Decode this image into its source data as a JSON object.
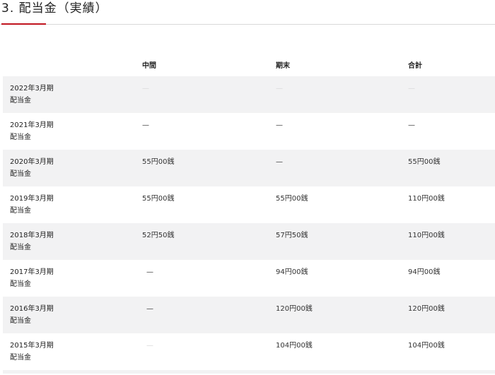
{
  "section": {
    "title": "3. 配当金（実績）"
  },
  "table": {
    "headers": [
      "中間",
      "期末",
      "合計"
    ],
    "rows": [
      {
        "period": "2022年3月期",
        "label": "配当金",
        "interim": "—",
        "year_end": "—",
        "total": "—",
        "faint": true
      },
      {
        "period": "2021年3月期",
        "label": "配当金",
        "interim": "—",
        "year_end": "—",
        "total": "—",
        "faint": false
      },
      {
        "period": "2020年3月期",
        "label": "配当金",
        "interim": "55円00銭",
        "year_end": "—",
        "total": "55円00銭",
        "faint": false
      },
      {
        "period": "2019年3月期",
        "label": "配当金",
        "interim": "55円00銭",
        "year_end": "55円00銭",
        "total": "110円00銭",
        "faint": false
      },
      {
        "period": "2018年3月期",
        "label": "配当金",
        "interim": "52円50銭",
        "year_end": "57円50銭",
        "total": "110円00銭",
        "faint": false
      },
      {
        "period": "2017年3月期",
        "label": "配当金",
        "interim": "—",
        "year_end": "94円00銭",
        "total": "94円00銭",
        "faint": false
      },
      {
        "period": "2016年3月期",
        "label": "配当金",
        "interim": "—",
        "year_end": "120円00銭",
        "total": "120円00銭",
        "faint": false
      },
      {
        "period": "2015年3月期",
        "label": "配当金",
        "interim": "—",
        "year_end": "104円00銭",
        "total": "104円00銭",
        "faint_interim": true
      }
    ]
  },
  "colors": {
    "accent": "#c0141e",
    "row_shade": "#f2f2f3",
    "rule": "#d9d9d9"
  }
}
